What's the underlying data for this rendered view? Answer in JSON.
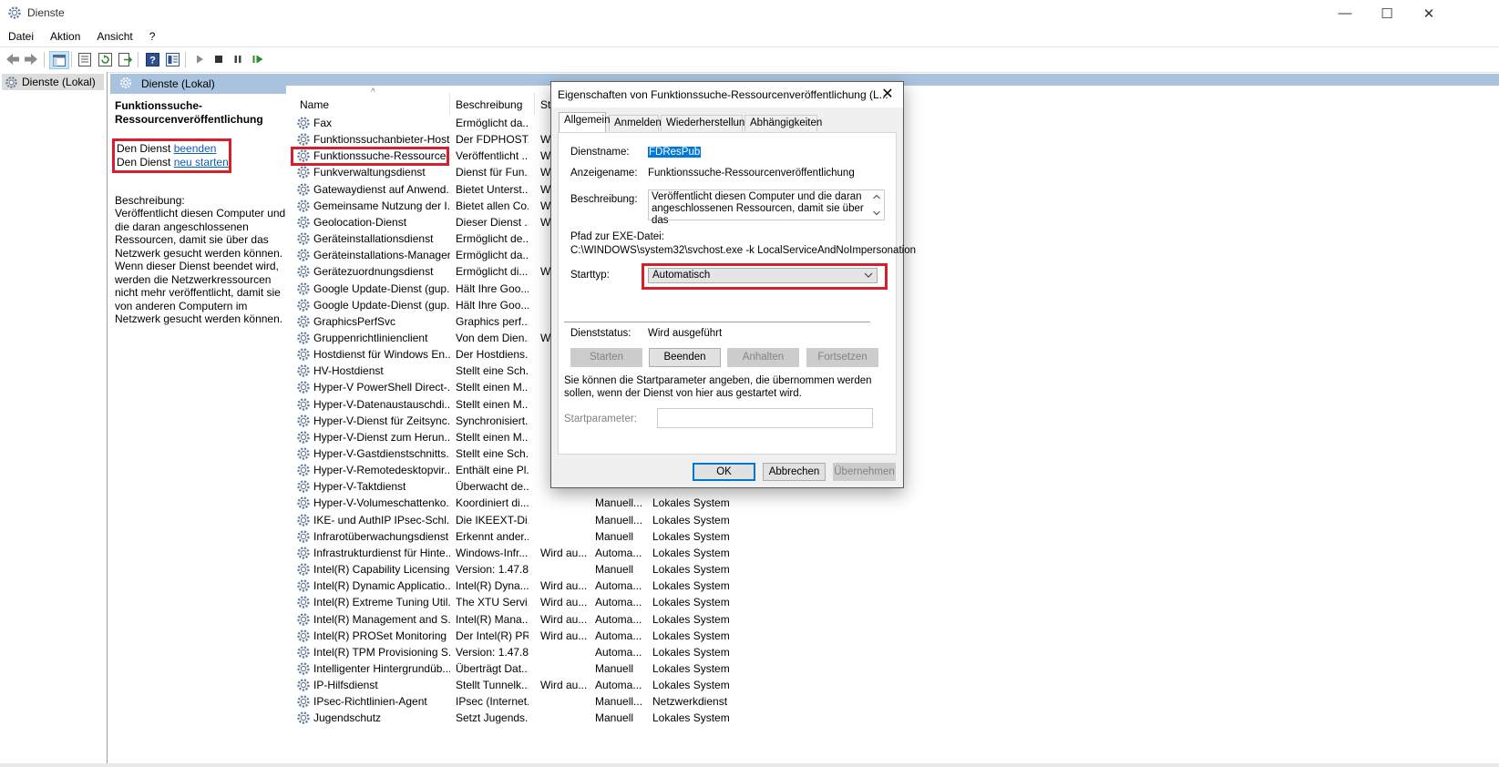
{
  "window": {
    "title": "Dienste",
    "minimize": "—",
    "maximize": "☐",
    "close": "✕"
  },
  "menu": [
    "Datei",
    "Aktion",
    "Ansicht",
    "?"
  ],
  "toolbar": {
    "icons": [
      "back-arrow-icon",
      "forward-arrow-icon",
      "console-tree-icon",
      "properties-icon",
      "refresh-icon",
      "export-list-icon",
      "help-icon",
      "snap-in-icon",
      "start-service-icon",
      "stop-service-icon",
      "pause-service-icon",
      "resume-service-icon"
    ]
  },
  "tree": {
    "item": "Dienste (Lokal)"
  },
  "main_header": {
    "title": "Dienste (Lokal)"
  },
  "desc_pane": {
    "service_title": "Funktionssuche-Ressourcenveröffentlichung",
    "action1_prefix": "Den Dienst ",
    "action1_link": "beenden",
    "action2_prefix": "Den Dienst ",
    "action2_link": "neu starten",
    "description_label": "Beschreibung:",
    "description_text": "Veröffentlicht diesen Computer und die daran angeschlossenen Ressourcen, damit sie über das Netzwerk gesucht werden können. Wenn dieser Dienst beendet wird, werden die Netzwerkressourcen nicht mehr veröffentlicht, damit sie von anderen Computern im Netzwerk gesucht werden können."
  },
  "list": {
    "columns": {
      "name": "Name",
      "desc": "Beschreibung",
      "status": "St",
      "start": "",
      "logon": ""
    },
    "sort_indicator": "^",
    "rows": [
      {
        "name": "Fax",
        "desc": "Ermöglicht da...",
        "status": "",
        "start": "",
        "logon": ""
      },
      {
        "name": "Funktionssuchanbieter-Host",
        "desc": "Der FDPHOST...",
        "status": "W",
        "start": "",
        "logon": ""
      },
      {
        "name": "Funktionssuche-Ressource...",
        "desc": "Veröffentlicht ...",
        "status": "W",
        "start": "",
        "logon": ""
      },
      {
        "name": "Funkverwaltungsdienst",
        "desc": "Dienst für Fun...",
        "status": "W",
        "start": "",
        "logon": ""
      },
      {
        "name": "Gatewaydienst auf Anwend...",
        "desc": "Bietet Unterst...",
        "status": "W",
        "start": "",
        "logon": ""
      },
      {
        "name": "Gemeinsame Nutzung der I...",
        "desc": "Bietet allen Co...",
        "status": "W",
        "start": "",
        "logon": ""
      },
      {
        "name": "Geolocation-Dienst",
        "desc": "Dieser Dienst ...",
        "status": "W",
        "start": "",
        "logon": ""
      },
      {
        "name": "Geräteinstallationsdienst",
        "desc": "Ermöglicht de...",
        "status": "",
        "start": "",
        "logon": ""
      },
      {
        "name": "Geräteinstallations-Manager",
        "desc": "Ermöglicht da...",
        "status": "",
        "start": "",
        "logon": ""
      },
      {
        "name": "Gerätezuordnungsdienst",
        "desc": "Ermöglicht di...",
        "status": "W",
        "start": "",
        "logon": ""
      },
      {
        "name": "Google Update-Dienst (gup...",
        "desc": "Hält Ihre Goo...",
        "status": "",
        "start": "",
        "logon": ""
      },
      {
        "name": "Google Update-Dienst (gup...",
        "desc": "Hält Ihre Goo...",
        "status": "",
        "start": "",
        "logon": ""
      },
      {
        "name": "GraphicsPerfSvc",
        "desc": "Graphics perf...",
        "status": "",
        "start": "",
        "logon": ""
      },
      {
        "name": "Gruppenrichtlinienclient",
        "desc": "Von dem Dien...",
        "status": "W",
        "start": "",
        "logon": ""
      },
      {
        "name": "Hostdienst für Windows En...",
        "desc": "Der Hostdiens...",
        "status": "",
        "start": "",
        "logon": ""
      },
      {
        "name": "HV-Hostdienst",
        "desc": "Stellt eine Sch...",
        "status": "",
        "start": "",
        "logon": ""
      },
      {
        "name": "Hyper-V PowerShell Direct-...",
        "desc": "Stellt einen M...",
        "status": "",
        "start": "",
        "logon": ""
      },
      {
        "name": "Hyper-V-Datenaustauschdi...",
        "desc": "Stellt einen M...",
        "status": "",
        "start": "",
        "logon": ""
      },
      {
        "name": "Hyper-V-Dienst für Zeitsync...",
        "desc": "Synchronisiert...",
        "status": "",
        "start": "",
        "logon": ""
      },
      {
        "name": "Hyper-V-Dienst zum Herun...",
        "desc": "Stellt einen M...",
        "status": "",
        "start": "",
        "logon": ""
      },
      {
        "name": "Hyper-V-Gastdienstschnitts...",
        "desc": "Stellt eine Sch...",
        "status": "",
        "start": "",
        "logon": ""
      },
      {
        "name": "Hyper-V-Remotedesktopvir...",
        "desc": "Enthält eine Pl...",
        "status": "",
        "start": "",
        "logon": ""
      },
      {
        "name": "Hyper-V-Taktdienst",
        "desc": "Überwacht de...",
        "status": "",
        "start": "",
        "logon": ""
      },
      {
        "name": "Hyper-V-Volumeschattenko...",
        "desc": "Koordiniert di...",
        "status": "",
        "start": "Manuell...",
        "logon": "Lokales System"
      },
      {
        "name": "IKE- und AuthIP IPsec-Schl...",
        "desc": "Die IKEEXT-Di...",
        "status": "",
        "start": "Manuell...",
        "logon": "Lokales System"
      },
      {
        "name": "Infrarotüberwachungsdienst",
        "desc": "Erkennt ander...",
        "status": "",
        "start": "Manuell",
        "logon": "Lokales System"
      },
      {
        "name": "Infrastrukturdienst für Hinte...",
        "desc": "Windows-Infr...",
        "status": "Wird au...",
        "start": "Automa...",
        "logon": "Lokales System"
      },
      {
        "name": "Intel(R) Capability Licensing...",
        "desc": "Version: 1.47.8...",
        "status": "",
        "start": "Manuell",
        "logon": "Lokales System"
      },
      {
        "name": "Intel(R) Dynamic Applicatio...",
        "desc": "Intel(R) Dyna...",
        "status": "Wird au...",
        "start": "Automa...",
        "logon": "Lokales System"
      },
      {
        "name": "Intel(R) Extreme Tuning Util...",
        "desc": "The XTU Servi...",
        "status": "Wird au...",
        "start": "Automa...",
        "logon": "Lokales System"
      },
      {
        "name": "Intel(R) Management and S...",
        "desc": "Intel(R) Mana...",
        "status": "Wird au...",
        "start": "Automa...",
        "logon": "Lokales System"
      },
      {
        "name": "Intel(R) PROSet Monitoring ...",
        "desc": "Der Intel(R) PR...",
        "status": "Wird au...",
        "start": "Automa...",
        "logon": "Lokales System"
      },
      {
        "name": "Intel(R) TPM Provisioning S...",
        "desc": "Version: 1.47.8...",
        "status": "",
        "start": "Automa...",
        "logon": "Lokales System"
      },
      {
        "name": "Intelligenter Hintergrundüb...",
        "desc": "Überträgt Dat...",
        "status": "",
        "start": "Manuell",
        "logon": "Lokales System"
      },
      {
        "name": "IP-Hilfsdienst",
        "desc": "Stellt Tunnelk...",
        "status": "Wird au...",
        "start": "Automa...",
        "logon": "Lokales System"
      },
      {
        "name": "IPsec-Richtlinien-Agent",
        "desc": "IPsec (Internet...",
        "status": "",
        "start": "Manuell...",
        "logon": "Netzwerkdienst"
      },
      {
        "name": "Jugendschutz",
        "desc": "Setzt Jugends...",
        "status": "",
        "start": "Manuell",
        "logon": "Lokales System"
      }
    ]
  },
  "dialog": {
    "title": "Eigenschaften von Funktionssuche-Ressourcenveröffentlichung (L...",
    "close": "✕",
    "tabs": [
      "Allgemein",
      "Anmelden",
      "Wiederherstellung",
      "Abhängigkeiten"
    ],
    "labels": {
      "service_name": "Dienstname:",
      "display_name": "Anzeigename:",
      "description": "Beschreibung:",
      "exe_path": "Pfad zur EXE-Datei:",
      "start_type": "Starttyp:",
      "service_status": "Dienststatus:",
      "start_params": "Startparameter:"
    },
    "values": {
      "service_name": "FDResPub",
      "display_name": "Funktionssuche-Ressourcenveröffentlichung",
      "description": "Veröffentlicht diesen Computer und die daran angeschlossenen Ressourcen, damit sie über das",
      "exe_path": "C:\\WINDOWS\\system32\\svchost.exe -k LocalServiceAndNoImpersonation",
      "start_type": "Automatisch",
      "service_status": "Wird ausgeführt",
      "start_params": ""
    },
    "service_buttons": [
      "Starten",
      "Beenden",
      "Anhalten",
      "Fortsetzen"
    ],
    "info_text": "Sie können die Startparameter angeben, die übernommen werden sollen, wenn der Dienst von hier aus gestartet wird.",
    "buttons": {
      "ok": "OK",
      "cancel": "Abbrechen",
      "apply": "Übernehmen"
    }
  },
  "colors": {
    "highlight": "#d4202a",
    "header_blue": "#a9c3df",
    "selection": "#0078d7"
  }
}
